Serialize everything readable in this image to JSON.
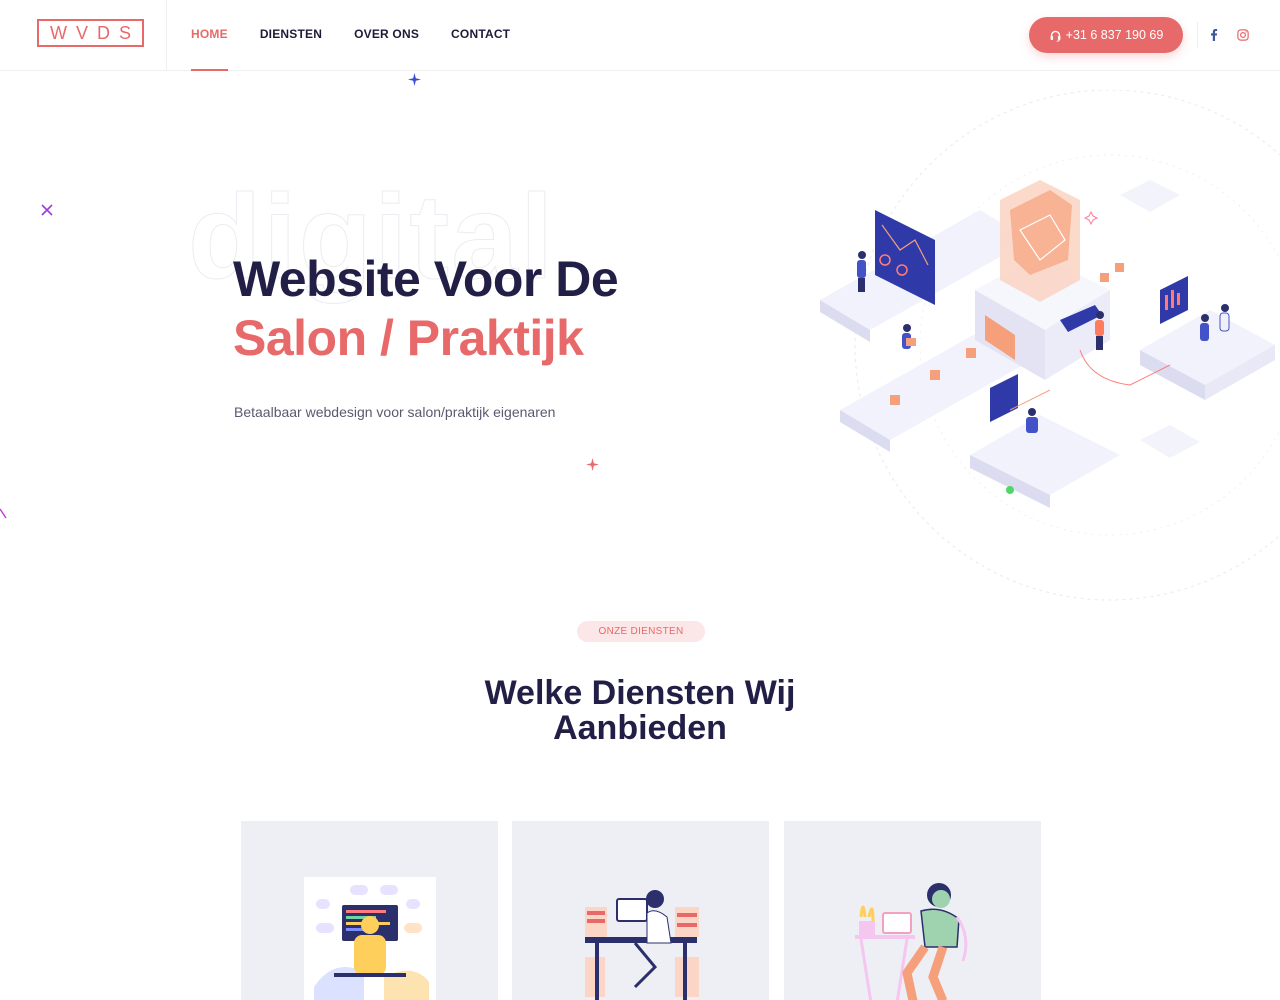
{
  "header": {
    "logo_text": "WVDS",
    "nav": [
      {
        "label": "HOME",
        "active": true
      },
      {
        "label": "DIENSTEN",
        "active": false
      },
      {
        "label": "OVER ONS",
        "active": false
      },
      {
        "label": "CONTACT",
        "active": false
      }
    ],
    "phone": "+31 6 837 190 69",
    "social": [
      "facebook-icon",
      "instagram-icon"
    ]
  },
  "hero": {
    "background_word": "digital",
    "title_line1": "Website Voor De",
    "title_line2": "Salon / Praktijk",
    "subtitle": "Betaalbaar webdesign voor salon/praktijk eigenaren"
  },
  "services": {
    "pill": "ONZE DIENSTEN",
    "title_line1": "Welke Diensten Wij",
    "title_line2": "Aanbieden",
    "cards": [
      {
        "icon": "developer-illustration"
      },
      {
        "icon": "designer-illustration"
      },
      {
        "icon": "consultant-illustration"
      }
    ]
  },
  "colors": {
    "accent": "#e86969",
    "heading": "#221f47",
    "card_bg": "#eeeff5"
  }
}
